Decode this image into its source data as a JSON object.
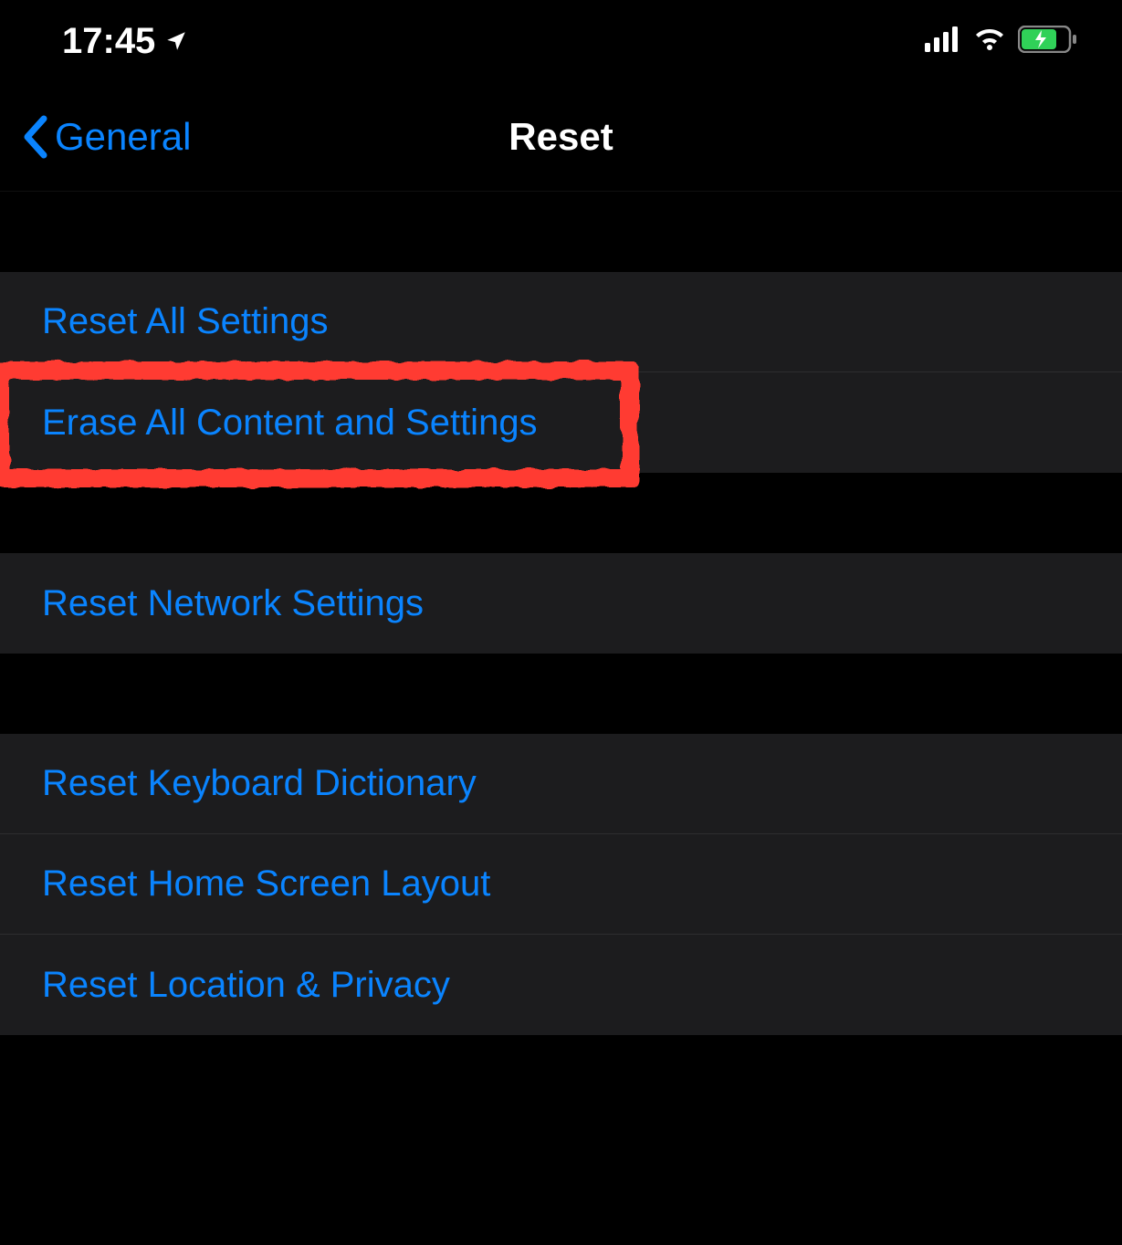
{
  "statusBar": {
    "time": "17:45"
  },
  "nav": {
    "backLabel": "General",
    "title": "Reset"
  },
  "groups": [
    {
      "items": [
        {
          "label": "Reset All Settings"
        },
        {
          "label": "Erase All Content and Settings",
          "highlighted": true
        }
      ]
    },
    {
      "items": [
        {
          "label": "Reset Network Settings"
        }
      ]
    },
    {
      "items": [
        {
          "label": "Reset Keyboard Dictionary"
        },
        {
          "label": "Reset Home Screen Layout"
        },
        {
          "label": "Reset Location & Privacy"
        }
      ]
    }
  ],
  "colors": {
    "link": "#0a84ff",
    "highlight": "#ff3b30",
    "batteryFill": "#30d158"
  }
}
